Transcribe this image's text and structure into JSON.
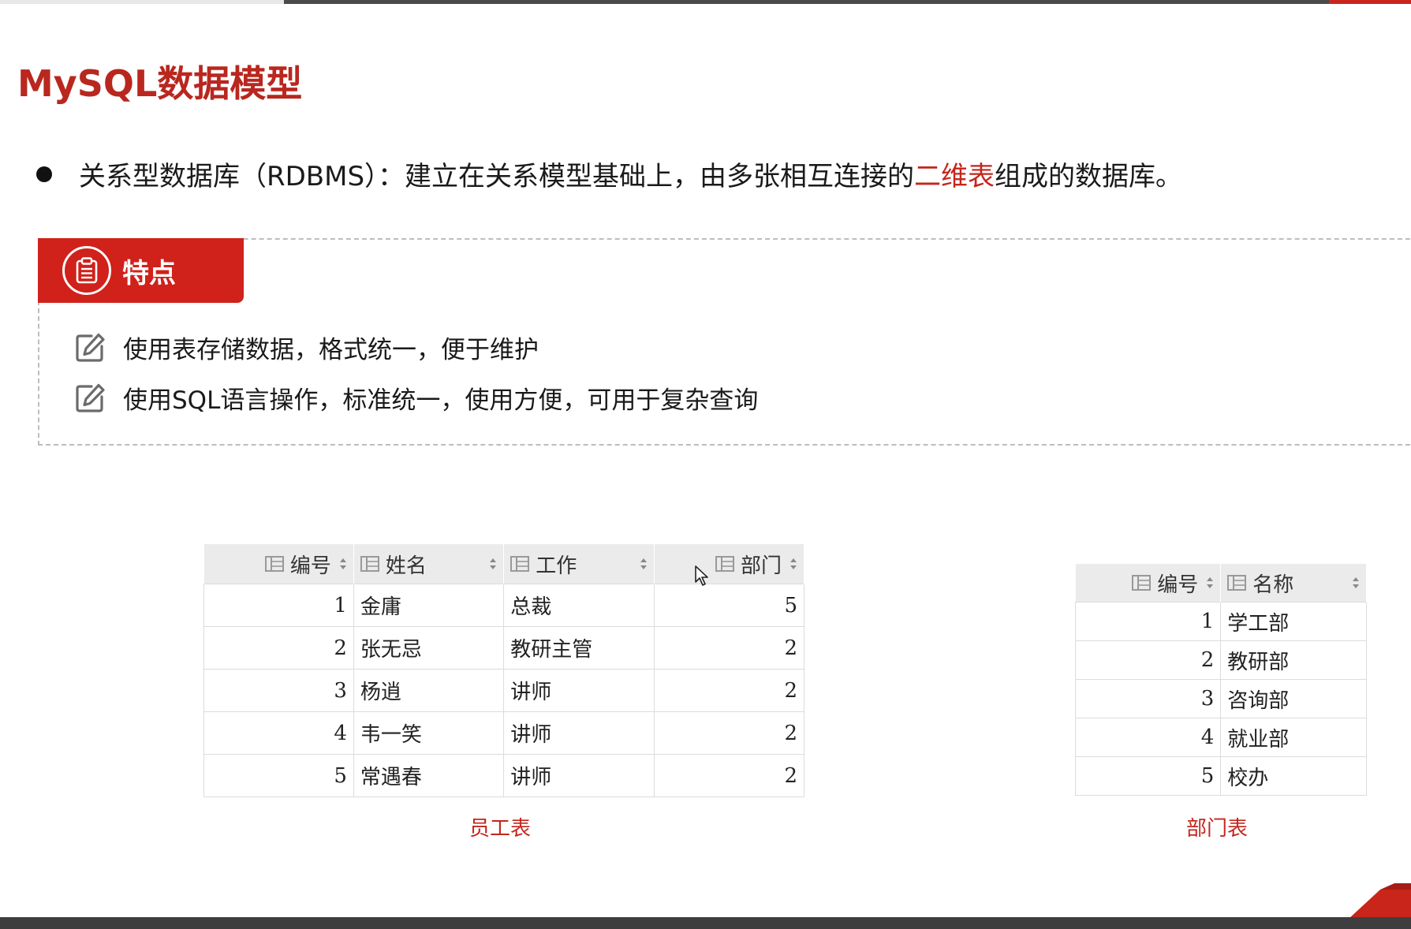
{
  "page": {
    "title": "MySQL数据模型"
  },
  "bullet": {
    "prefix": "关系型数据库（RDBMS）：建立在关系模型基础上，由多张相互连接的",
    "highlight": "二维表",
    "suffix": "组成的数据库。"
  },
  "features": {
    "tab_label": "特点",
    "tab_icon": "clipboard-icon",
    "item_icon": "edit-icon",
    "items": [
      "使用表存储数据，格式统一，便于维护",
      "使用SQL语言操作，标准统一，使用方便，可用于复杂查询"
    ]
  },
  "employee_table": {
    "caption": "员工表",
    "header_icon": "table-column-icon",
    "sort_icon": "sort-icon",
    "columns": [
      "编号",
      "姓名",
      "工作",
      "部门"
    ],
    "rows": [
      [
        "1",
        "金庸",
        "总裁",
        "5"
      ],
      [
        "2",
        "张无忌",
        "教研主管",
        "2"
      ],
      [
        "3",
        "杨逍",
        "讲师",
        "2"
      ],
      [
        "4",
        "韦一笑",
        "讲师",
        "2"
      ],
      [
        "5",
        "常遇春",
        "讲师",
        "2"
      ]
    ]
  },
  "department_table": {
    "caption": "部门表",
    "columns": [
      "编号",
      "名称"
    ],
    "rows": [
      [
        "1",
        "学工部"
      ],
      [
        "2",
        "教研部"
      ],
      [
        "3",
        "咨询部"
      ],
      [
        "4",
        "就业部"
      ],
      [
        "5",
        "校办"
      ]
    ]
  },
  "colors": {
    "accent_red": "#c4261c",
    "title_red": "#b9271f",
    "tab_red": "#d0211a"
  }
}
